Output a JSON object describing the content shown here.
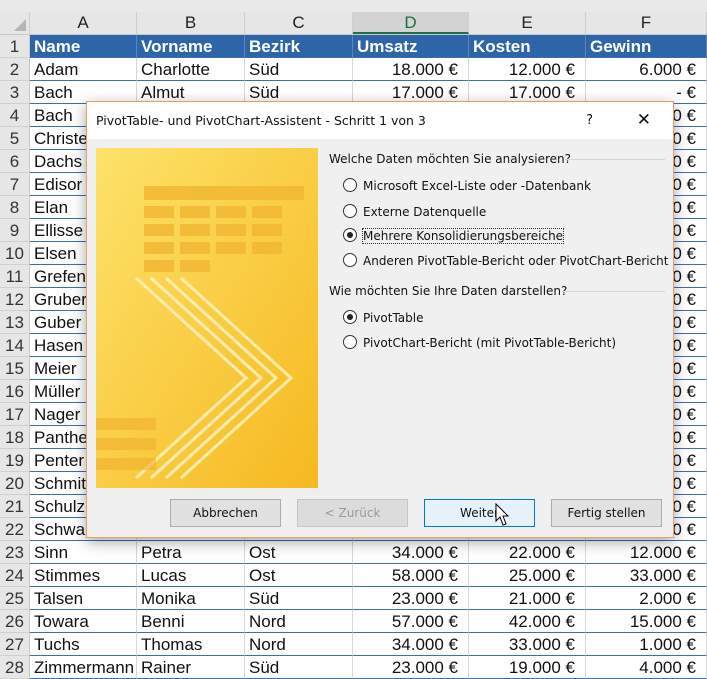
{
  "columns": [
    "A",
    "B",
    "C",
    "D",
    "E",
    "F"
  ],
  "selected_column": "D",
  "header_row": [
    "Name",
    "Vorname",
    "Bezirk",
    "Umsatz",
    "Kosten",
    "Gewinn"
  ],
  "rows": [
    [
      "Adam",
      "Charlotte",
      "Süd",
      "18.000 €",
      "12.000 €",
      "6.000 €"
    ],
    [
      "Bach",
      "Almut",
      "Süd",
      "17.000 €",
      "17.000 €",
      "-      €"
    ],
    [
      "Bach",
      "",
      "",
      "",
      "",
      "0 €"
    ],
    [
      "Christe",
      "",
      "",
      "",
      "",
      "0 €"
    ],
    [
      "Dachs",
      "",
      "",
      "",
      "",
      "0 €"
    ],
    [
      "Edisor",
      "",
      "",
      "",
      "",
      "0 €"
    ],
    [
      "Elan",
      "",
      "",
      "",
      "",
      "0 €"
    ],
    [
      "Ellisse",
      "",
      "",
      "",
      "",
      "0 €"
    ],
    [
      "Elsen",
      "",
      "",
      "",
      "",
      "0 €"
    ],
    [
      "Grefen",
      "",
      "",
      "",
      "",
      "0 €"
    ],
    [
      "Gruber",
      "",
      "",
      "",
      "",
      "0 €"
    ],
    [
      "Guber",
      "",
      "",
      "",
      "",
      "0 €"
    ],
    [
      "Hasen",
      "",
      "",
      "",
      "",
      "0 €"
    ],
    [
      "Meier",
      "",
      "",
      "",
      "",
      "0 €"
    ],
    [
      "Müller",
      "",
      "",
      "",
      "",
      "0 €"
    ],
    [
      "Nager",
      "",
      "",
      "",
      "",
      "0 €"
    ],
    [
      "Panthe",
      "",
      "",
      "",
      "",
      "0 €"
    ],
    [
      "Penter",
      "",
      "",
      "",
      "",
      "0 €"
    ],
    [
      "Schmit",
      "",
      "",
      "",
      "",
      "0 €"
    ],
    [
      "Schulz",
      "",
      "",
      "",
      "",
      "0 €"
    ],
    [
      "Schwa",
      "",
      "",
      "",
      "",
      "0 €"
    ],
    [
      "Sinn",
      "Petra",
      "Ost",
      "34.000 €",
      "22.000 €",
      "12.000 €"
    ],
    [
      "Stimmes",
      "Lucas",
      "Ost",
      "58.000 €",
      "25.000 €",
      "33.000 €"
    ],
    [
      "Talsen",
      "Monika",
      "Süd",
      "23.000 €",
      "21.000 €",
      "2.000 €"
    ],
    [
      "Towara",
      "Benni",
      "Nord",
      "57.000 €",
      "42.000 €",
      "15.000 €"
    ],
    [
      "Tuchs",
      "Thomas",
      "Nord",
      "34.000 €",
      "33.000 €",
      "1.000 €"
    ],
    [
      "Zimmermann",
      "Rainer",
      "Süd",
      "23.000 €",
      "19.000 €",
      "4.000 €"
    ]
  ],
  "dialog": {
    "title": "PivotTable- und PivotChart-Assistent - Schritt 1 von 3",
    "help": "?",
    "close": "✕",
    "section1": "Welche Daten möchten Sie analysieren?",
    "source_options": [
      {
        "label": "Microsoft Excel-Liste oder -Datenbank",
        "selected": false
      },
      {
        "label": "Externe Datenquelle",
        "selected": false
      },
      {
        "label": "Mehrere Konsolidierungsbereiche",
        "selected": true
      },
      {
        "label": "Anderen PivotTable-Bericht oder PivotChart-Bericht",
        "selected": false
      }
    ],
    "section2": "Wie möchten Sie Ihre Daten darstellen?",
    "report_options": [
      {
        "label": "PivotTable",
        "selected": true
      },
      {
        "label": "PivotChart-Bericht (mit PivotTable-Bericht)",
        "selected": false
      }
    ],
    "buttons": {
      "cancel": "Abbrechen",
      "back": "< Zurück",
      "next": "Weiter",
      "finish": "Fertig stellen"
    }
  },
  "colors": {
    "header_blue": "#2e64a8",
    "selected_col_green": "#1e7145",
    "accent": "#0078d7"
  }
}
